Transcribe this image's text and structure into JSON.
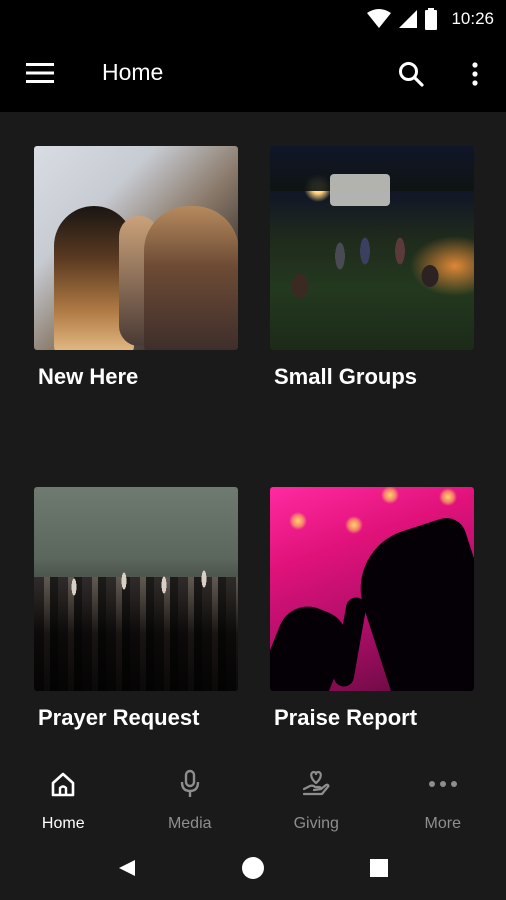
{
  "status_bar": {
    "time": "10:26",
    "icons": [
      "wifi-icon",
      "signal-icon",
      "battery-icon"
    ]
  },
  "app_bar": {
    "title": "Home",
    "menu_icon": "hamburger-menu-icon",
    "search_icon": "search-icon",
    "overflow_icon": "more-vertical-icon"
  },
  "tiles": [
    {
      "label": "New Here"
    },
    {
      "label": "Small Groups"
    },
    {
      "label": "Prayer Request"
    },
    {
      "label": "Praise Report"
    }
  ],
  "bottom_nav": {
    "items": [
      {
        "label": "Home",
        "icon": "home-icon",
        "active": true
      },
      {
        "label": "Media",
        "icon": "microphone-icon",
        "active": false
      },
      {
        "label": "Giving",
        "icon": "giving-hand-heart-icon",
        "active": false
      },
      {
        "label": "More",
        "icon": "more-horizontal-icon",
        "active": false
      }
    ]
  },
  "system_nav": {
    "icons": [
      "back-icon",
      "home-circle-icon",
      "recents-square-icon"
    ]
  },
  "colors": {
    "background": "#1a1a1a",
    "bar": "#000000",
    "text_primary": "#ffffff",
    "text_inactive": "#8e8e8e"
  }
}
